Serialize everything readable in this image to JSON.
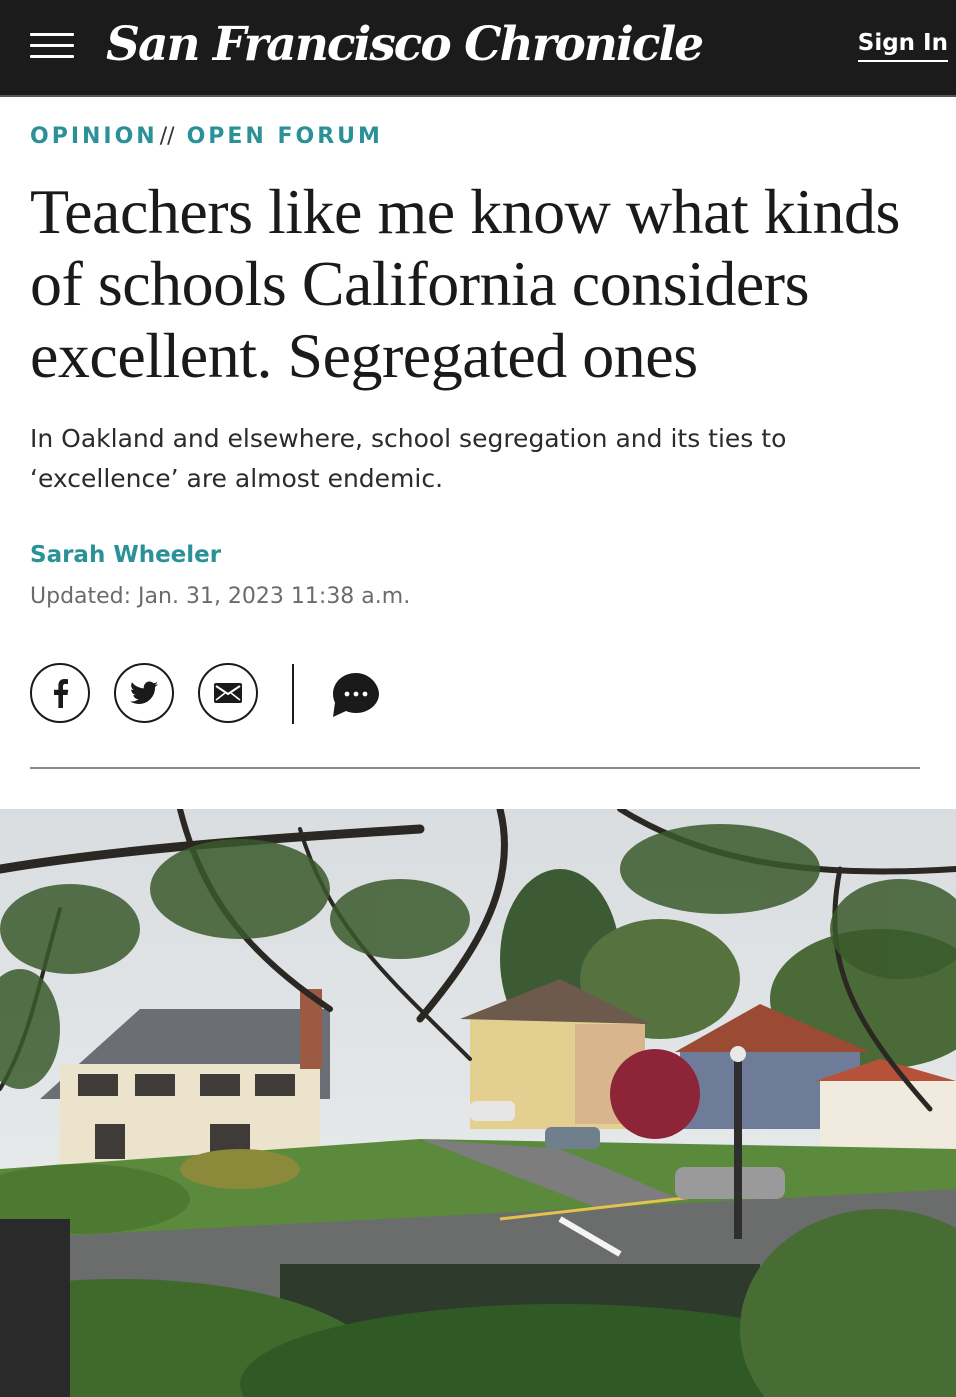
{
  "header": {
    "logo_text": "San Francisco Chronicle",
    "sign_in_label": "Sign In",
    "menu_icon": "hamburger-menu-icon",
    "background": "#1b1b1b"
  },
  "article": {
    "section": "OPINION",
    "separator": "//",
    "subsection": "OPEN FORUM",
    "headline": "Teachers like me know what kinds of schools California considers excellent. Segregated ones",
    "dek": "In Oakland and elsewhere, school segregation and its ties to ‘excellence’ are almost endemic.",
    "author": "Sarah Wheeler",
    "updated": "Updated: Jan. 31, 2023 11:38 a.m.",
    "accent_color": "#2a9196"
  },
  "share": {
    "icons": [
      "facebook-icon",
      "twitter-icon",
      "email-icon",
      "comment-icon"
    ]
  },
  "hero_image": {
    "description_icon": "residential-street-photo"
  }
}
